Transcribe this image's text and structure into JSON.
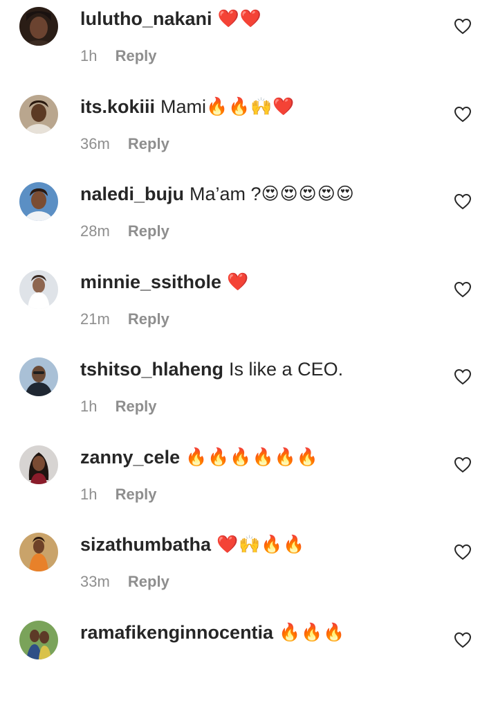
{
  "comments": [
    {
      "username": "lulutho_nakani",
      "text": "",
      "emoji": "❤️❤️",
      "time": "1h",
      "reply": "Reply",
      "avatar_bg": "#2a1d16",
      "avatar_skin": "#6b4330",
      "avatar_accent": "#1a1210"
    },
    {
      "username": "its.kokiii",
      "text": "Mami",
      "emoji": "🔥🔥🙌❤️",
      "time": "36m",
      "reply": "Reply",
      "avatar_bg": "#b9a68e",
      "avatar_skin": "#5c3a24",
      "avatar_accent": "#e7e1d8"
    },
    {
      "username": "naledi_buju",
      "text": "Ma’am ?",
      "emoji": "😍😍😍😍😍",
      "time": "28m",
      "reply": "Reply",
      "avatar_bg": "#5b8fc4",
      "avatar_skin": "#7b4d33",
      "avatar_accent": "#f0f2f5"
    },
    {
      "username": "minnie_ssithole",
      "text": "",
      "emoji": "❤️",
      "time": "21m",
      "reply": "Reply",
      "avatar_bg": "#dfe3e8",
      "avatar_skin": "#8e6650",
      "avatar_accent": "#ffffff"
    },
    {
      "username": "tshitso_hlaheng",
      "text": "Is like a CEO.",
      "emoji": "",
      "time": "1h",
      "reply": "Reply",
      "avatar_bg": "#a9c0d6",
      "avatar_skin": "#6a4a36",
      "avatar_accent": "#1f2732"
    },
    {
      "username": "zanny_cele",
      "text": "",
      "emoji": "🔥🔥🔥🔥🔥🔥",
      "time": "1h",
      "reply": "Reply",
      "avatar_bg": "#d7d4d2",
      "avatar_skin": "#7a4b33",
      "avatar_accent": "#8a1c2a"
    },
    {
      "username": "sizathumbatha",
      "text": "",
      "emoji": "❤️🙌🔥🔥",
      "time": "33m",
      "reply": "Reply",
      "avatar_bg": "#c9a36a",
      "avatar_skin": "#6e4128",
      "avatar_accent": "#e8812a"
    },
    {
      "username": "ramafikenginnocentia",
      "text": "",
      "emoji": "🔥🔥🔥",
      "time": "",
      "reply": "",
      "avatar_bg": "#7aa35a",
      "avatar_skin": "#5d3a27",
      "avatar_accent": "#2e4f86"
    }
  ],
  "icons": {
    "like": "heart-outline-icon"
  },
  "colors": {
    "username": "#262626",
    "meta": "#8e8e8e",
    "background": "#ffffff"
  }
}
